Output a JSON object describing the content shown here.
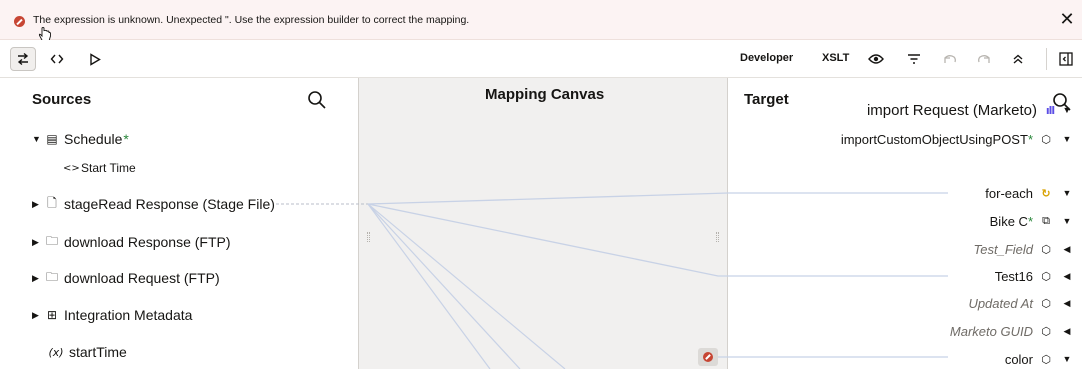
{
  "banner": {
    "message": "The expression is unknown. Unexpected \". Use the expression builder to correct the mapping.",
    "close_glyph": "✕"
  },
  "toolbar": {
    "developer_label": "Developer",
    "xslt_label": "XSLT",
    "icons": [
      "swap-icon",
      "code-icon",
      "play-icon",
      "eye-icon",
      "filter-icon",
      "undo-icon",
      "redo-icon",
      "collapse-icon",
      "panel-toggle-icon"
    ]
  },
  "sources": {
    "title": "Sources",
    "items": [
      {
        "label": "Schedule",
        "star": "*",
        "icon": "calendar-icon",
        "expanded": true
      },
      {
        "label": "Start Time",
        "icon": "element-icon"
      },
      {
        "label": "stageRead Response (Stage File)",
        "icon": "file-icon",
        "expanded": false
      },
      {
        "label": "download Response (FTP)",
        "icon": "folder-icon",
        "expanded": false
      },
      {
        "label": "download Request (FTP)",
        "icon": "folder-icon",
        "expanded": false
      },
      {
        "label": "Integration Metadata",
        "icon": "grid-icon",
        "expanded": false
      },
      {
        "label": "startTime",
        "icon": "variable-icon"
      }
    ]
  },
  "canvas": {
    "title": "Mapping Canvas"
  },
  "target": {
    "title": "Target",
    "items": [
      {
        "label": "import Request (Marketo)",
        "icon": "marketo-icon"
      },
      {
        "label": "importCustomObjectUsingPOST",
        "star": "*",
        "icon": "object-icon"
      },
      {
        "label": "for-each",
        "icon": "loop-icon"
      },
      {
        "label": "Bike C",
        "star": "*",
        "icon": "repeat-icon"
      },
      {
        "label": "Test_Field",
        "icon": "field-icon",
        "italic": true
      },
      {
        "label": "Test16",
        "icon": "field-icon"
      },
      {
        "label": "Updated At",
        "icon": "object-icon",
        "italic": true
      },
      {
        "label": "Marketo GUID",
        "icon": "field-icon",
        "italic": true
      },
      {
        "label": "color",
        "icon": "field-icon"
      }
    ]
  },
  "colors": {
    "error": "#c74634",
    "required_star": "#29863a",
    "marketo": "#5c4ee5",
    "for_each": "#d7a100",
    "mapping_line": "#c8d2e6"
  }
}
